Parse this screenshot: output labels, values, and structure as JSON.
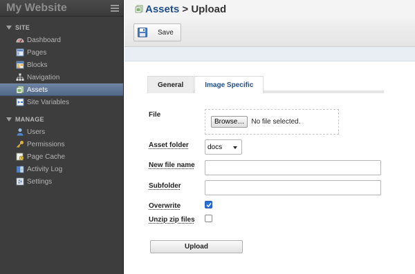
{
  "site": {
    "title": "My Website"
  },
  "sidebar": {
    "sections": [
      {
        "label": "SITE",
        "items": [
          {
            "label": "Dashboard",
            "icon": "dashboard-icon"
          },
          {
            "label": "Pages",
            "icon": "pages-icon"
          },
          {
            "label": "Blocks",
            "icon": "blocks-icon"
          },
          {
            "label": "Navigation",
            "icon": "navigation-icon"
          },
          {
            "label": "Assets",
            "icon": "assets-icon",
            "active": true
          },
          {
            "label": "Site Variables",
            "icon": "site-variables-icon"
          }
        ]
      },
      {
        "label": "MANAGE",
        "items": [
          {
            "label": "Users",
            "icon": "users-icon"
          },
          {
            "label": "Permissions",
            "icon": "key-icon"
          },
          {
            "label": "Page Cache",
            "icon": "page-cache-icon"
          },
          {
            "label": "Activity Log",
            "icon": "activity-log-icon"
          },
          {
            "label": "Settings",
            "icon": "settings-icon"
          }
        ]
      }
    ]
  },
  "breadcrumb": {
    "parent": "Assets",
    "separator": ">",
    "current": "Upload"
  },
  "toolbar": {
    "save_label": "Save"
  },
  "tabs": [
    {
      "label": "General",
      "active": true
    },
    {
      "label": "Image Specific",
      "active": false
    }
  ],
  "form": {
    "file_label": "File",
    "browse_label": "Browse…",
    "file_status": "No file selected.",
    "asset_folder_label": "Asset folder",
    "asset_folder_value": "docs",
    "new_file_name_label": "New file name",
    "new_file_name_value": "",
    "subfolder_label": "Subfolder",
    "subfolder_value": "",
    "overwrite_label": "Overwrite",
    "overwrite_checked": true,
    "unzip_label": "Unzip zip files",
    "unzip_checked": false,
    "upload_label": "Upload"
  },
  "colors": {
    "sidebar_bg": "#3d3d3d",
    "active_item": "#5a6e8c",
    "link": "#1f4e8a",
    "checkbox": "#2a6fd6"
  }
}
